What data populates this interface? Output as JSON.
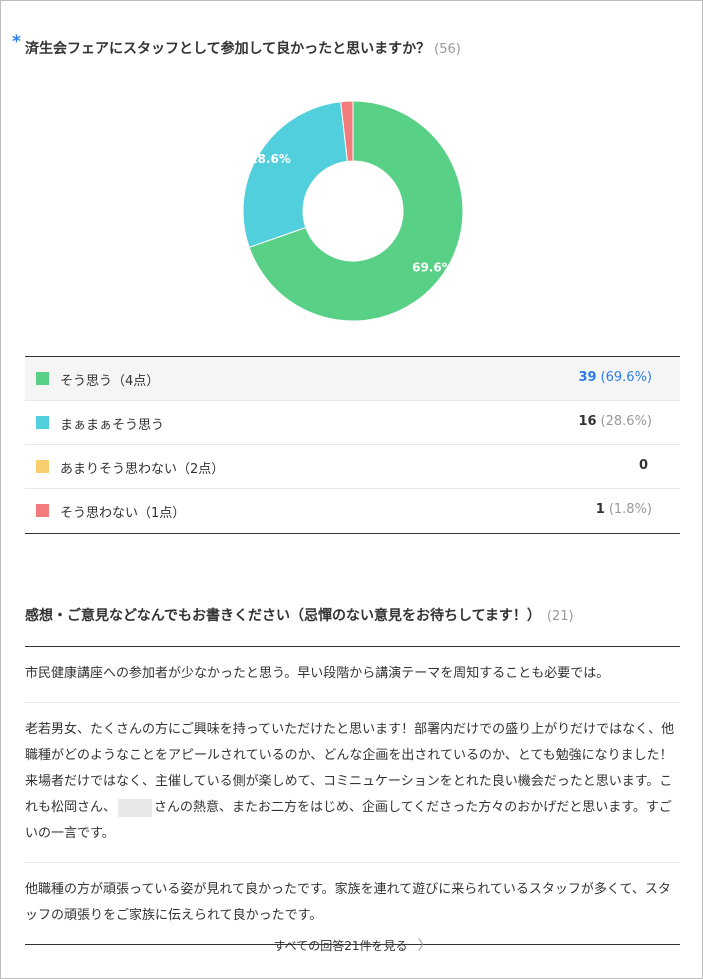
{
  "question1": {
    "required_mark": "*",
    "title": "済生会フェアにスタッフとして参加して良かったと思いますか？",
    "response_count": "(56)"
  },
  "chart_data": {
    "type": "pie",
    "title": "",
    "slices": [
      {
        "label": "そう思う（4点）",
        "value": 39,
        "percent": 69.6,
        "percent_label": "69.6%",
        "color": "#58d085"
      },
      {
        "label": "まぁまぁそう思う",
        "value": 16,
        "percent": 28.6,
        "percent_label": "28.6%",
        "color": "#52cfdc"
      },
      {
        "label": "あまりそう思わない（2点）",
        "value": 0,
        "percent": 0,
        "percent_label": "",
        "color": "#f9cf6e"
      },
      {
        "label": "そう思わない（1点）",
        "value": 1,
        "percent": 1.8,
        "percent_label": "",
        "color": "#f47b7b"
      }
    ]
  },
  "legend": [
    {
      "label": "そう思う（4点）",
      "count": "39",
      "percent": "(69.6%)",
      "color": "#58d085"
    },
    {
      "label": "まぁまぁそう思う",
      "count": "16",
      "percent": "(28.6%)",
      "color": "#52cfdc"
    },
    {
      "label": "あまりそう思わない（2点）",
      "count": "0",
      "percent": "",
      "color": "#f9cf6e"
    },
    {
      "label": "そう思わない（1点）",
      "count": "1",
      "percent": "(1.8%)",
      "color": "#f47b7b"
    }
  ],
  "question2": {
    "title": "感想・ご意見などなんでもお書きください（忌憚のない意見をお待ちしてます！）",
    "response_count": "(21)",
    "answers": [
      {
        "text": "市民健康講座への参加者が少なかったと思う。早い段階から講演テーマを周知することも必要では。"
      },
      {
        "text_before": "老若男女、たくさんの方にご興味を持っていただけたと思います！部署内だけでの盛り上がりだけではなく、他職種がどのようなことをアピールされているのか、どんな企画を出されているのか、とても勉強になりました！来場者だけではなく、主催している側が楽しめて、コミニュケーションをとれた良い機会だったと思います。これも松岡さん、",
        "text_after": "さんの熱意、またお二方をはじめ、企画してくださった方々のおかげだと思います。すごいの一言です。"
      },
      {
        "text": "他職種の方が頑張っている姿が見れて良かったです。家族を連れて遊びに来られているスタッフが多くて、スタッフの頑張りをご家族に伝えられて良かったです。"
      }
    ]
  },
  "see_all": {
    "label": "すべての回答21件を見る",
    "chevron": "chevron-right-icon"
  }
}
